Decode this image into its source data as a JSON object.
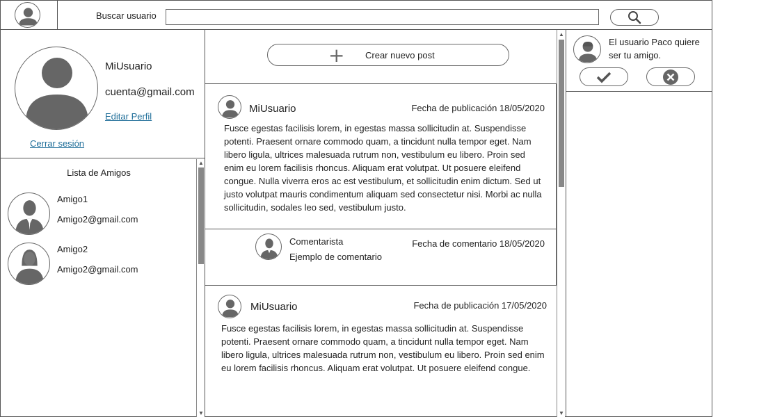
{
  "search": {
    "label": "Buscar usuario",
    "value": "",
    "placeholder": ""
  },
  "profile": {
    "name": "MiUsuario",
    "email": "cuenta@gmail.com",
    "edit_label": "Editar Perfil",
    "logout_label": "Cerrar sesión"
  },
  "friends": {
    "title": "Lista de Amigos",
    "items": [
      {
        "name": "Amigo1",
        "email": "Amigo2@gmail.com",
        "avatar": "male-user-icon"
      },
      {
        "name": "Amigo2",
        "email": "Amigo2@gmail.com",
        "avatar": "female-user-icon"
      }
    ]
  },
  "new_post": {
    "label": "Crear nuevo post"
  },
  "posts": [
    {
      "user": "MiUsuario",
      "date": "Fecha de publicación 18/05/2020",
      "body": "Fusce egestas facilisis lorem, in egestas massa sollicitudin at. Suspendisse potenti. Praesent ornare commodo quam, a tincidunt nulla tempor eget. Nam libero ligula, ultrices malesuada rutrum non, vestibulum eu libero. Proin sed enim eu lorem facilisis rhoncus. Aliquam erat volutpat. Ut posuere eleifend congue. Nulla viverra eros ac est vestibulum, et sollicitudin enim dictum. Sed ut justo volutpat mauris condimentum aliquam sed consectetur nisi. Morbi ac nulla sollicitudin, sodales leo sed, vestibulum justo.",
      "comment": {
        "author": "Comentarista",
        "text": "Ejemplo de comentario",
        "date": "Fecha de comentario 18/05/2020"
      }
    },
    {
      "user": "MiUsuario",
      "date": "Fecha de publicación 17/05/2020",
      "body": "Fusce egestas facilisis lorem, in egestas massa sollicitudin at. Suspendisse potenti. Praesent ornare commodo quam, a tincidunt nulla tempor eget. Nam libero ligula, ultrices malesuada rutrum non, vestibulum eu libero. Proin sed enim eu lorem facilisis rhoncus. Aliquam erat volutpat. Ut posuere eleifend congue."
    }
  ],
  "notification": {
    "text": "El usuario Paco quiere ser tu amigo.",
    "accept_icon": "checkmark-icon",
    "reject_icon": "close-circle-icon"
  },
  "icons": {
    "search": "search-icon",
    "add": "plus-icon",
    "avatar": "user-icon"
  },
  "colors": {
    "link": "#1f6e99",
    "border": "#555555",
    "icon": "#666666"
  }
}
